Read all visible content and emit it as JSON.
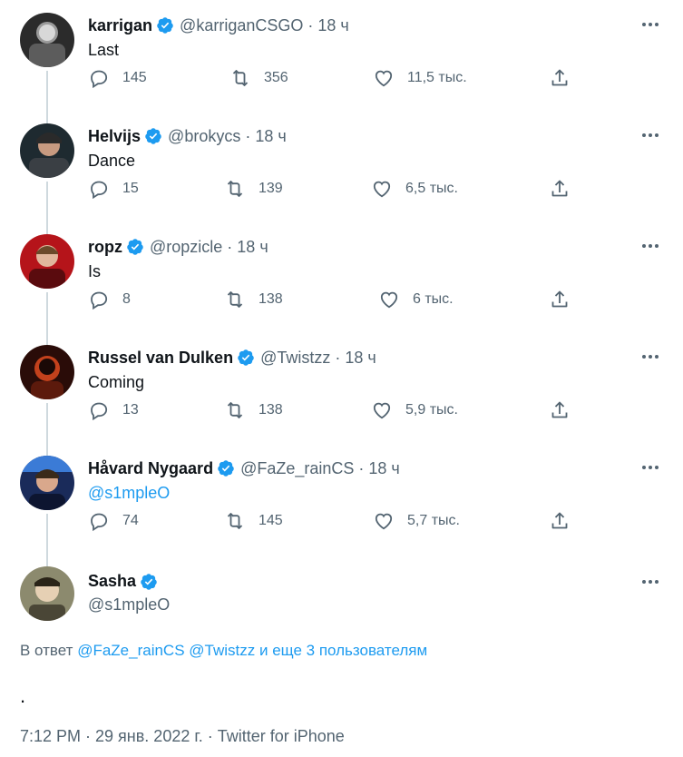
{
  "colors": {
    "accent": "#1d9bf0",
    "secondary_text": "#536471",
    "primary_text": "#0f1419",
    "thread_line": "#cfd9de"
  },
  "replies": [
    {
      "name": "karrigan",
      "handle": "@karriganCSGO",
      "time": "18 ч",
      "text": "Last",
      "text_is_link": false,
      "replies": "145",
      "retweets": "356",
      "likes": "11,5 тыс.",
      "verified": true
    },
    {
      "name": "Helvijs",
      "handle": "@brokycs",
      "time": "18 ч",
      "text": "Dance",
      "text_is_link": false,
      "replies": "15",
      "retweets": "139",
      "likes": "6,5 тыс.",
      "verified": true
    },
    {
      "name": "ropz",
      "handle": "@ropzicle",
      "time": "18 ч",
      "text": "Is",
      "text_is_link": false,
      "replies": "8",
      "retweets": "138",
      "likes": "6 тыс.",
      "verified": true
    },
    {
      "name": "Russel van Dulken",
      "handle": "@Twistzz",
      "time": "18 ч",
      "text": "Coming",
      "text_is_link": false,
      "replies": "13",
      "retweets": "138",
      "likes": "5,9 тыс.",
      "verified": true
    },
    {
      "name": "Håvard Nygaard",
      "handle": "@FaZe_rainCS",
      "time": "18 ч",
      "text": "@s1mpleO",
      "text_is_link": true,
      "replies": "74",
      "retweets": "145",
      "likes": "5,7 тыс.",
      "verified": true
    }
  ],
  "main": {
    "name": "Sasha",
    "handle": "@s1mpleO",
    "reply_prefix": "В ответ",
    "reply_user_1": "@FaZe_rainCS",
    "reply_user_2": "@Twistzz",
    "reply_more": "и еще 3 пользователям",
    "body": ".",
    "timestamp": "7:12 PM · 29 янв. 2022 г. · Twitter for iPhone"
  },
  "icons": {
    "more": "more-horizontal-icon",
    "reply": "reply-bubble-icon",
    "retweet": "retweet-icon",
    "like": "heart-icon",
    "share": "share-icon",
    "verified": "verified-badge-icon"
  }
}
